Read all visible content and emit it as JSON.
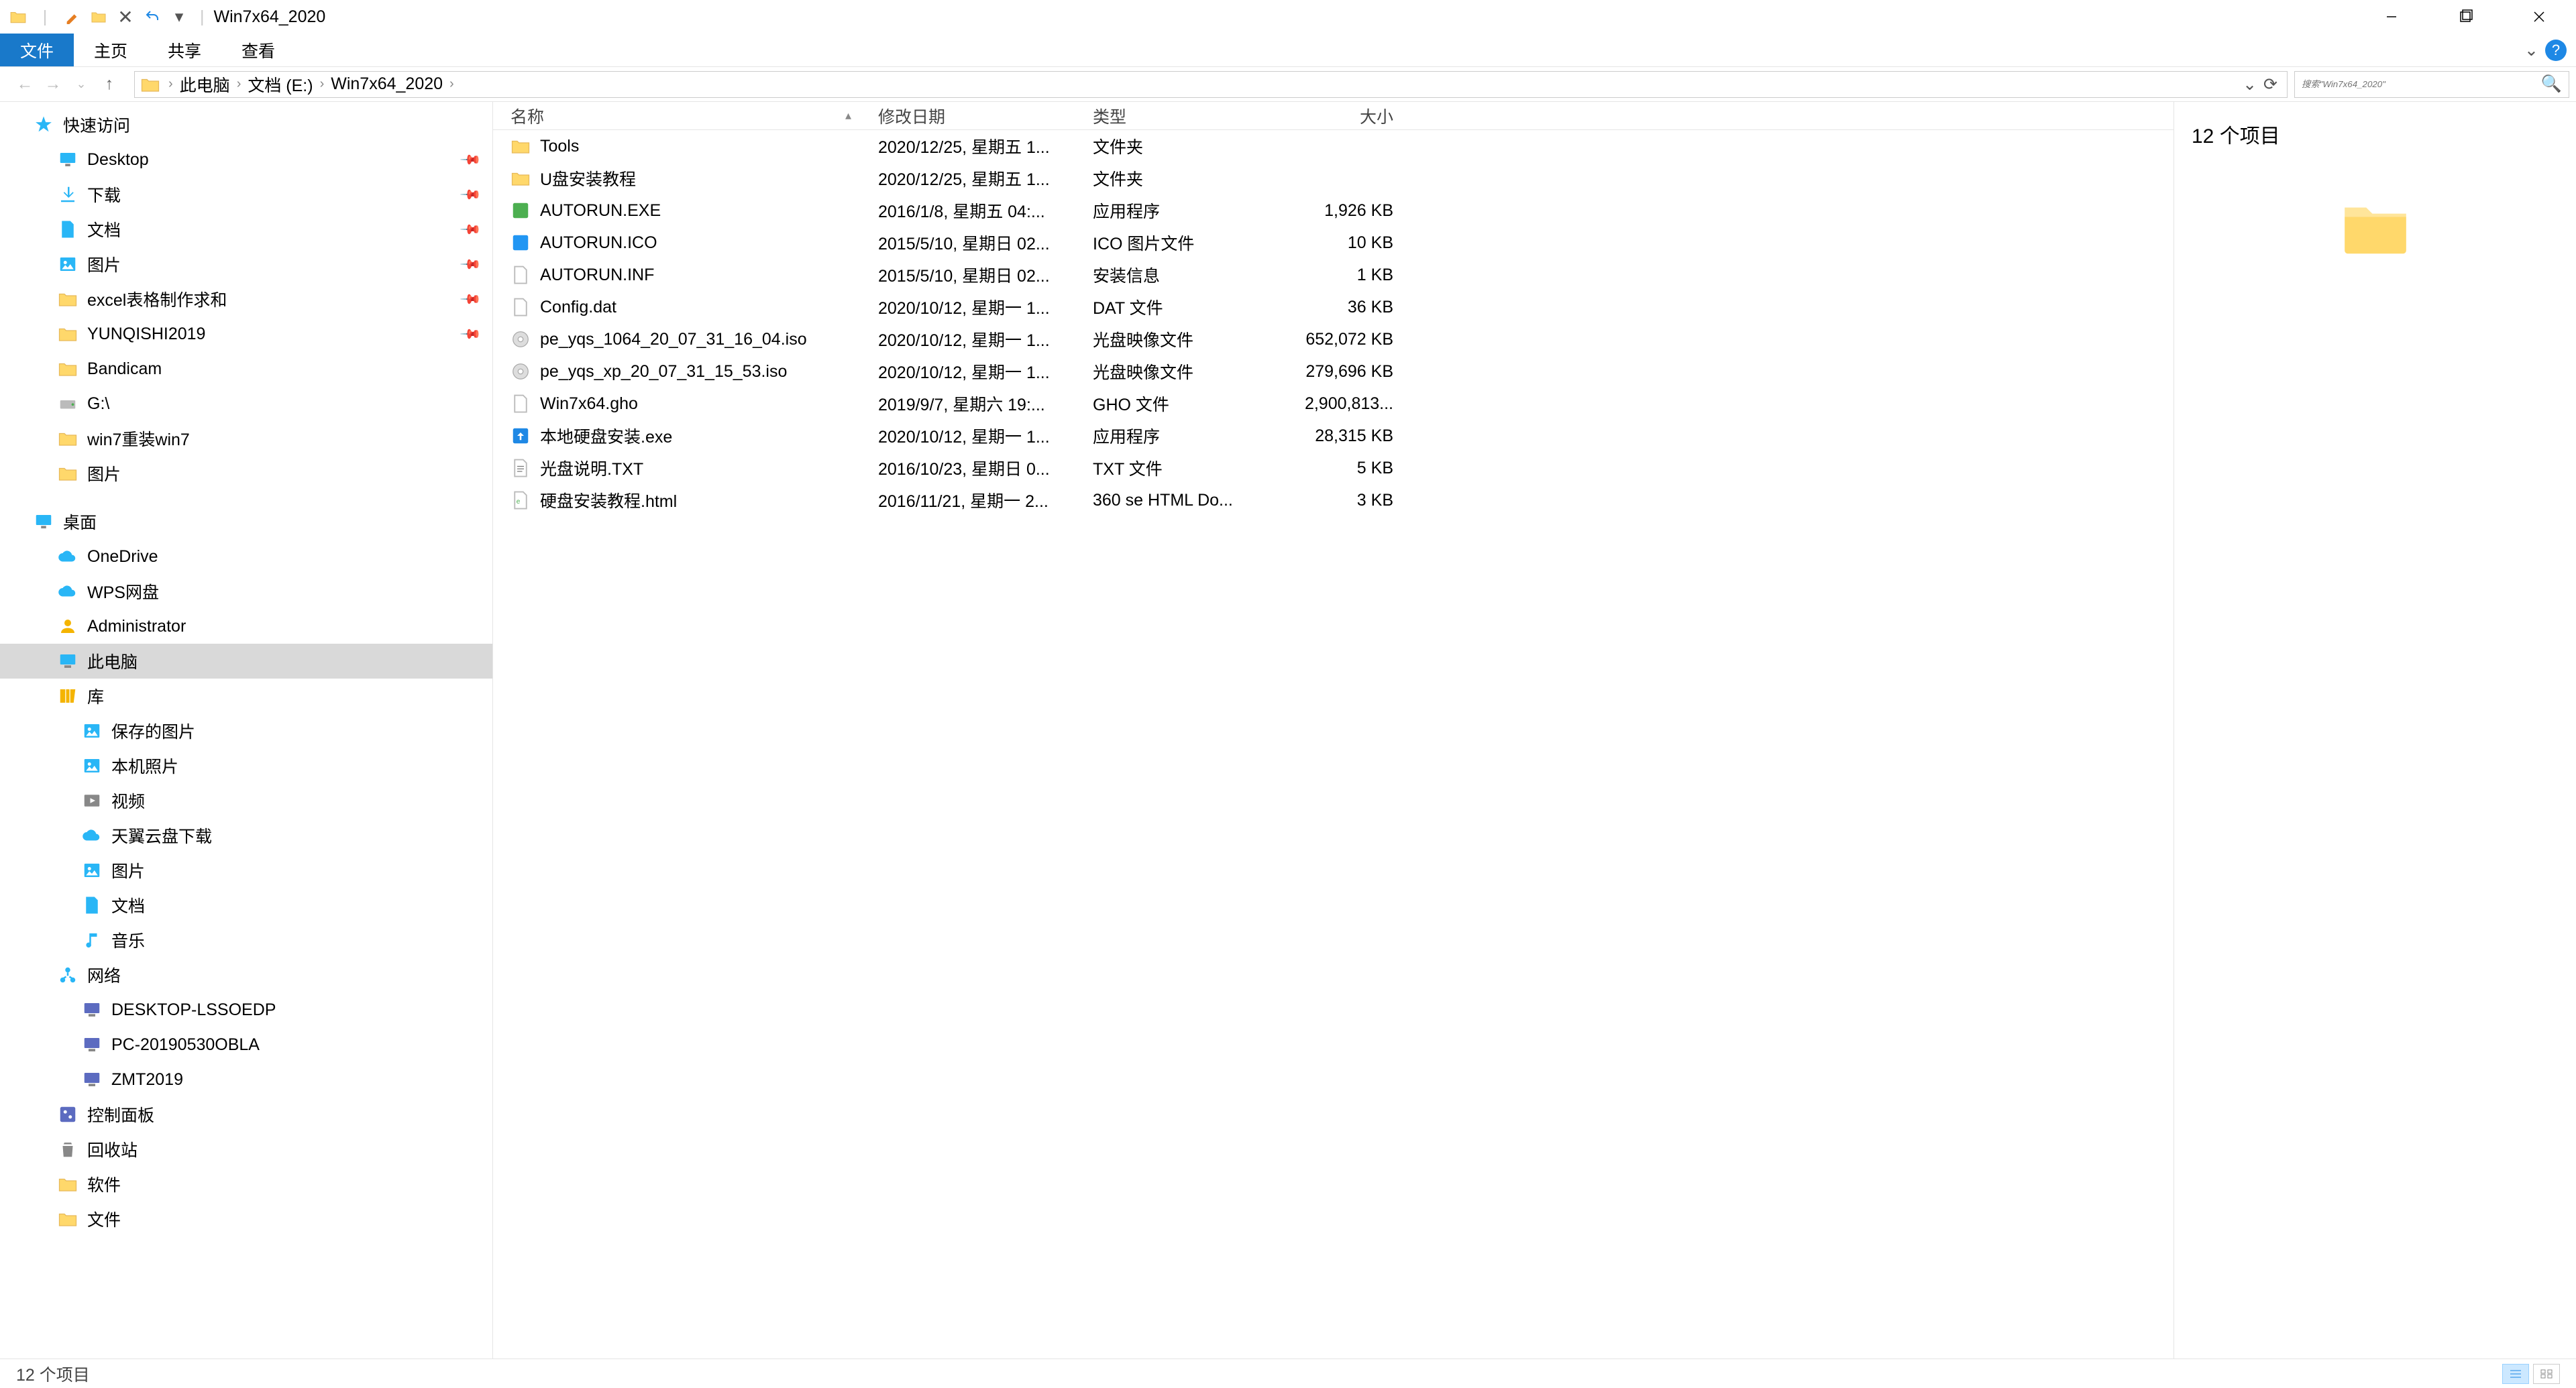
{
  "title": "Win7x64_2020",
  "ribbon": {
    "file": "文件",
    "home": "主页",
    "share": "共享",
    "view": "查看"
  },
  "breadcrumb": [
    "此电脑",
    "文档 (E:)",
    "Win7x64_2020"
  ],
  "search": {
    "placeholder": "搜索\"Win7x64_2020\""
  },
  "sidebar": {
    "quick_access": "快速访问",
    "quick_items": [
      {
        "label": "Desktop",
        "icon": "desktop",
        "pinned": true
      },
      {
        "label": "下载",
        "icon": "downloads",
        "pinned": true
      },
      {
        "label": "文档",
        "icon": "documents",
        "pinned": true
      },
      {
        "label": "图片",
        "icon": "pictures",
        "pinned": true
      },
      {
        "label": "excel表格制作求和",
        "icon": "folder",
        "pinned": true
      },
      {
        "label": "YUNQISHI2019",
        "icon": "folder",
        "pinned": true
      },
      {
        "label": "Bandicam",
        "icon": "folder",
        "pinned": false
      },
      {
        "label": "G:\\",
        "icon": "drive",
        "pinned": false
      },
      {
        "label": "win7重装win7",
        "icon": "folder",
        "pinned": false
      },
      {
        "label": "图片",
        "icon": "folder",
        "pinned": false
      }
    ],
    "desktop": "桌面",
    "desktop_items": [
      {
        "label": "OneDrive",
        "icon": "cloud"
      },
      {
        "label": "WPS网盘",
        "icon": "cloud"
      },
      {
        "label": "Administrator",
        "icon": "user"
      },
      {
        "label": "此电脑",
        "icon": "thispc",
        "selected": true
      },
      {
        "label": "库",
        "icon": "libraries"
      }
    ],
    "library_items": [
      {
        "label": "保存的图片",
        "icon": "pictures"
      },
      {
        "label": "本机照片",
        "icon": "pictures"
      },
      {
        "label": "视频",
        "icon": "videos"
      },
      {
        "label": "天翼云盘下载",
        "icon": "cloud"
      },
      {
        "label": "图片",
        "icon": "pictures"
      },
      {
        "label": "文档",
        "icon": "documents"
      },
      {
        "label": "音乐",
        "icon": "music"
      }
    ],
    "network": "网络",
    "network_items": [
      {
        "label": "DESKTOP-LSSOEDP",
        "icon": "pc"
      },
      {
        "label": "PC-20190530OBLA",
        "icon": "pc"
      },
      {
        "label": "ZMT2019",
        "icon": "pc"
      }
    ],
    "control_panel": "控制面板",
    "recycle_bin": "回收站",
    "software": "软件",
    "files": "文件"
  },
  "columns": {
    "name": "名称",
    "modified": "修改日期",
    "type": "类型",
    "size": "大小"
  },
  "files": [
    {
      "name": "Tools",
      "modified": "2020/12/25, 星期五 1...",
      "type": "文件夹",
      "size": "",
      "icon": "folder"
    },
    {
      "name": "U盘安装教程",
      "modified": "2020/12/25, 星期五 1...",
      "type": "文件夹",
      "size": "",
      "icon": "folder"
    },
    {
      "name": "AUTORUN.EXE",
      "modified": "2016/1/8, 星期五 04:...",
      "type": "应用程序",
      "size": "1,926 KB",
      "icon": "exe"
    },
    {
      "name": "AUTORUN.ICO",
      "modified": "2015/5/10, 星期日 02...",
      "type": "ICO 图片文件",
      "size": "10 KB",
      "icon": "ico"
    },
    {
      "name": "AUTORUN.INF",
      "modified": "2015/5/10, 星期日 02...",
      "type": "安装信息",
      "size": "1 KB",
      "icon": "file"
    },
    {
      "name": "Config.dat",
      "modified": "2020/10/12, 星期一 1...",
      "type": "DAT 文件",
      "size": "36 KB",
      "icon": "file"
    },
    {
      "name": "pe_yqs_1064_20_07_31_16_04.iso",
      "modified": "2020/10/12, 星期一 1...",
      "type": "光盘映像文件",
      "size": "652,072 KB",
      "icon": "iso"
    },
    {
      "name": "pe_yqs_xp_20_07_31_15_53.iso",
      "modified": "2020/10/12, 星期一 1...",
      "type": "光盘映像文件",
      "size": "279,696 KB",
      "icon": "iso"
    },
    {
      "name": "Win7x64.gho",
      "modified": "2019/9/7, 星期六 19:...",
      "type": "GHO 文件",
      "size": "2,900,813...",
      "icon": "file"
    },
    {
      "name": "本地硬盘安装.exe",
      "modified": "2020/10/12, 星期一 1...",
      "type": "应用程序",
      "size": "28,315 KB",
      "icon": "exeblue"
    },
    {
      "name": "光盘说明.TXT",
      "modified": "2016/10/23, 星期日 0...",
      "type": "TXT 文件",
      "size": "5 KB",
      "icon": "txt"
    },
    {
      "name": "硬盘安装教程.html",
      "modified": "2016/11/21, 星期一 2...",
      "type": "360 se HTML Do...",
      "size": "3 KB",
      "icon": "html"
    }
  ],
  "preview": {
    "count_label": "12 个项目"
  },
  "status": {
    "text": "12 个项目"
  }
}
